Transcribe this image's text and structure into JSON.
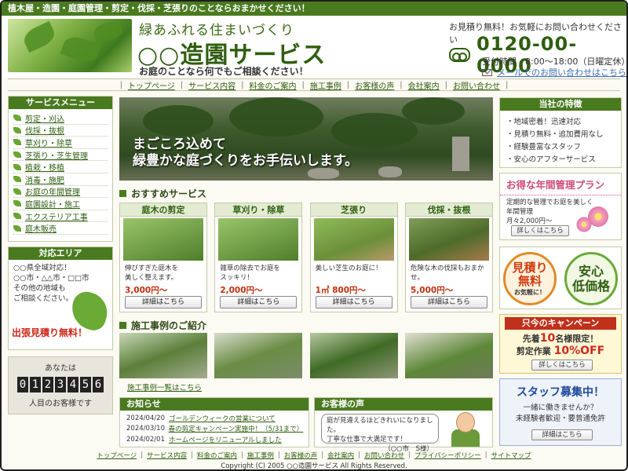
{
  "topbar": {
    "text": "植木屋・造園・庭園管理・剪定・伐採・芝張りのことならおまかせください！"
  },
  "header": {
    "catch": "緑あふれる住まいづくり",
    "company": "○○造園サービス",
    "subcatch": "お庭のことなら何でもご相談ください！",
    "contact_note": "お見積り無料！お気軽にお問い合わせください",
    "phone": "0120-00-0000",
    "hours": "受付時間　8:00～18:00（日曜定休）",
    "mail_link": "メールでのお問い合わせはこちら"
  },
  "gnav": [
    "トップページ",
    "サービス内容",
    "料金のご案内",
    "施工事例",
    "お客様の声",
    "会社案内",
    "お問い合わせ"
  ],
  "service_menu": {
    "title": "サービスメニュー",
    "items": [
      "剪定・刈込",
      "伐採・抜根",
      "草刈り・除草",
      "芝張り・芝生管理",
      "植栽・移植",
      "消毒・施肥",
      "お庭の年間管理",
      "庭園設計・施工",
      "エクステリア工事",
      "庭木販売"
    ]
  },
  "area": {
    "title": "対応エリア",
    "line1": "○○県全域対応！",
    "line2": "○○市・△△市・□□市",
    "line3": "その他の地域も",
    "line4": "ご相談ください。",
    "red": "出張見積り無料！"
  },
  "counter": {
    "label": "あなたは",
    "digits": [
      "0",
      "1",
      "2",
      "3",
      "4",
      "5",
      "6"
    ],
    "sub": "人目のお客様です"
  },
  "hero": {
    "line1": "まごころ込めて",
    "line2": "緑豊かな庭づくりをお手伝いします。"
  },
  "recommended": {
    "title": "おすすめサービス",
    "button_label": "詳細はこちら",
    "cards": [
      {
        "title": "庭木の剪定",
        "desc1": "伸びすぎた庭木を",
        "desc2": "美しく整えます。",
        "price": "3,000円～"
      },
      {
        "title": "草刈り・除草",
        "desc1": "雑草の除去でお庭を",
        "desc2": "スッキリ！",
        "price": "2,000円～"
      },
      {
        "title": "芝張り",
        "desc1": "美しい芝生のお庭に！",
        "desc2": "",
        "price": "1㎡ 800円～"
      },
      {
        "title": "伐採・抜根",
        "desc1": "危険な木の伐採もおまかせ。",
        "desc2": "",
        "price": "5,000円～"
      }
    ]
  },
  "works": {
    "title": "施工事例のご紹介",
    "link": "施工事例一覧はこちら"
  },
  "news": {
    "title": "お知らせ",
    "items": [
      {
        "date": "2024/04/20",
        "text": "ゴールデンウィークの営業について"
      },
      {
        "date": "2024/03/10",
        "text": "春の剪定キャンペーン実施中！（5/31まで）"
      },
      {
        "date": "2024/02/01",
        "text": "ホームページをリニューアルしました"
      }
    ]
  },
  "voice": {
    "title": "お客様の声",
    "text1": "庭が見違えるほどきれいになりました。",
    "text2": "丁寧な仕事で大満足です！",
    "sig": "（○○市　S様）"
  },
  "features": {
    "title": "当社の特徴",
    "items": [
      "・地域密着！迅速対応",
      "・見積り無料・追加費用なし",
      "・経験豊富なスタッフ",
      "・安心のアフターサービス"
    ]
  },
  "plan": {
    "title": "お得な年間管理プラン",
    "desc1": "定期的な管理でお庭を美しく",
    "desc2": "年間管理",
    "desc3": "月々2,000円～",
    "button": "詳しくはこちら"
  },
  "badges": {
    "b1_line1": "見積り",
    "b1_line2": "無料",
    "b1_small": "お気軽に！",
    "b2_line1": "安心",
    "b2_line2": "低価格"
  },
  "campaign": {
    "title": "只今のキャンペーン",
    "l1_pre": "先着",
    "l1_num": "10",
    "l1_post": "名様限定！",
    "l2_pre": "剪定作業",
    "l2_off": "10%OFF",
    "button": "詳しくはこちら"
  },
  "staff": {
    "title": "スタッフ募集中！",
    "d1": "一緒に働きませんか？",
    "d2": "未経験者歓迎・要普通免許",
    "button": "詳細はこちら"
  },
  "footnav": [
    "トップページ",
    "サービス内容",
    "料金のご案内",
    "施工事例",
    "お客様の声",
    "会社案内",
    "お問い合わせ",
    "プライバシーポリシー",
    "サイトマップ"
  ],
  "copyright": "Copyright (C) 2005 ○○造園サービス All Rights Reserved."
}
